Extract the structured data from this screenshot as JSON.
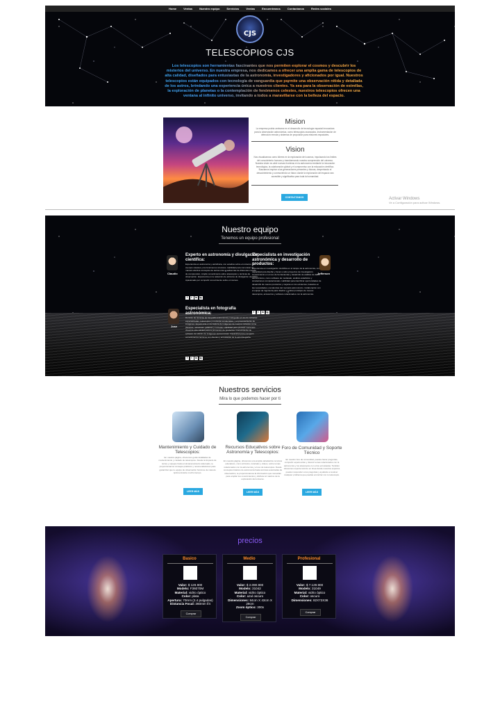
{
  "nav": [
    "Home",
    "Ventas",
    "Nuestro equipo",
    "Servicios",
    "Ventas",
    "Encuentranos",
    "Contactanos",
    "Redes sociales"
  ],
  "hero": {
    "logo_text": "CJS",
    "title": "TELESCOPIOS CJS",
    "text": "Los telescopios son herramientas fascinantes que nos permiten explorar el cosmos y descubrir los misterios del universo. En nuestra empresa, nos dedicamos a ofrecer una amplia gama de telescopios de alta calidad, diseñados para entusiastas de la astronomía, investigadores y aficionados por igual. Nuestros telescopios están equipados con tecnología de vanguardia que permite una observación nítida y detallada de los astros, brindando una experiencia única a nuestros clientes. Ya sea para la observación de estrellas, la exploración de planetas o la contemplación de fenómenos celestes, nuestros telescopios ofrecen una ventana al infinito universo, invitando a todos a maravillarse con la belleza del espacio."
  },
  "mission": {
    "mision_title": "Mision",
    "mision_text": "La empresa podría centrarse en el desarrollo de tecnología espacial innovadora para la observación astronómica, como telescopios avanzados, instrumentación de detección remota y sistemas de propulsión para misiones espaciales.",
    "vision_title": "Vision",
    "vision_text": "Nos visualizamos como líderes en la exploración del cosmos, impulsando los límites del conocimiento humano y transformando nuestra comprensión del universo. Nuestra visión es abrir nuevas fronteras en la astronomía mediante la innovación tecnológica, la colaboración global y el compromiso con la educación científica. Buscamos inspirar a las generaciones presentes y futuras, despertando el descubrimiento y conmoviendo un futuro donde la exploración del espacio sea accesible y significativa para toda la humanidad.",
    "button": "CONTACTANOS",
    "watermark_title": "Activar Windows",
    "watermark_sub": "Ve a Configuración para activar Windows."
  },
  "team": {
    "title": "Nuestro equipo",
    "subtitle": "Tenemos un equipo profesional",
    "members": [
      {
        "name": "Claudio",
        "role": "Experto en astronomía y divulgación científica:",
        "text": "Experiencia en astronomía y astrofísica, con estudios sobre el universo, los cuerpos celestes y los fenómenos cósmicos. Habilidad para comunicar de manera efectiva conceptos de astronomía a audiencias de diferentes niveles de comprensión. Amplio conocimiento sobre telescopios y técnicas de observación. Experiencia en la redacción de artículos de divulgación científica. Apasionado por compartir conocimiento sobre el cosmos."
      },
      {
        "name": "Jefferson",
        "role": "Especialista en investigación astronómica y desarrollo de productos:",
        "text": "Experiencia en investigación científica en el campo de la astronomía, con capacidad para diseñar y llevar a cabo proyectos de investigación. Conocimiento en el uso de herramientas y desarrollo de análisis de datos astronómicos, como software de modelado, análisis estadístico y simulaciones computacionales. Habilidad para identificar oportunidades de desarrollo de nuevos productos y mejoras en los existentes, basados en las necesidades y tendencias del mercado astronómico. Colaboración con el equipo de ingeniería para diseñar y probar prototipos de nuevos telescopios, accesorios y software relacionados con la astronomía."
      },
      {
        "name": "Jose",
        "role": "Especialista en fotografía astronómica:",
        "text": "Dominio de técnicas de fotografía astronómica, incluyendo el uso de cámaras especializadas, telescopios y monturas ecuatoriales, y el procesamiento de imágenes. Experiencia en la captura de imágenes de cuerpos celestes como planetas, nebulosas, galaxias y cometas. Habilidad para producir contenido visual de alta calidad para la promoción de productos. Conocimiento de software de edición de imágenes astronómicas. Capacidad para compartir conocimientos técnicos con clientes y entusiastas de la astrofotografía."
      }
    ],
    "social": [
      "f",
      "t",
      "in",
      "ig"
    ]
  },
  "services": {
    "title": "Nuestros servicios",
    "subtitle": "Mira lo que podemos hacer por ti",
    "items": [
      {
        "name": "Mantenimiento y Cuidado de Telescopios:",
        "text": "En nuestra página, ofrecemos guías detalladas de mantenimiento y cuidado de telescopios. Desde la limpieza de lentes y espejos hasta el almacenamiento adecuado, te proporcionamos consejos prácticos y recomendaciones para garantizar que tu equipo de observación funcione de manera óptima durante mucho tiempo.",
        "button": "LEER MÁS"
      },
      {
        "name": "Recursos Educativos sobre Astronomía y Telescopios:",
        "text": "En nuestra página, ofrecemos una amplia variedad de recursos educativos, como artículos, tutoriales y videos, sobre temas relacionados con la astronomía y el uso de telescopios. Desde conceptos básicos de astronomía hasta técnicas avanzadas de observación, te proporcionamos la información que necesitas para ampliar tus conocimientos y disfrutar al máximo de la exploración del universo.",
        "button": "LEER MÁS"
      },
      {
        "name": "Foro de Comunidad y Soporte Técnico",
        "text": "En nuestro foro de comunidad, puedes hacer preguntas, compartir experiencias y discutir temas relacionados con la astronomía y los telescopios con otros entusiastas. También ofrecemos soporte técnico en línea donde nuestros expertos pueden responder a tus preguntas y ayudarte a resolver cualquier problema que puedas encontrar con tu telescopio.",
        "button": "LEER MÁS"
      }
    ]
  },
  "prices": {
    "title": "precios",
    "buy_label": "Comprar",
    "plans": [
      {
        "name": "Basico",
        "specs": [
          [
            "Valor:",
            "$ 129.900"
          ],
          [
            "Modelo:",
            "F36070M"
          ],
          [
            "Material:",
            "vidrio óptico"
          ],
          [
            "Color:",
            "plata"
          ],
          [
            "Apertura:",
            "70mm (2.4 pulgadas)"
          ],
          [
            "Distancia Focal:",
            "360mm f/4"
          ]
        ]
      },
      {
        "name": "Medio",
        "specs": [
          [
            "Valor:",
            "$ 2.090.900"
          ],
          [
            "Modelo:",
            "31042"
          ],
          [
            "Material:",
            "vidrio óptico"
          ],
          [
            "Color:",
            "azul oscuro"
          ],
          [
            "Dimensiones:",
            "84cm X 43cm X 29cm"
          ],
          [
            "Zoom óptico:",
            "300x"
          ]
        ]
      },
      {
        "name": "Profesional",
        "specs": [
          [
            "Valor:",
            "$ 7.129.900"
          ],
          [
            "Modelo:",
            "31049"
          ],
          [
            "Material:",
            "vidrio óptico"
          ],
          [
            "Color:",
            "oscuro"
          ],
          [
            "Dimensiones:",
            "82X72X36"
          ]
        ]
      }
    ]
  }
}
